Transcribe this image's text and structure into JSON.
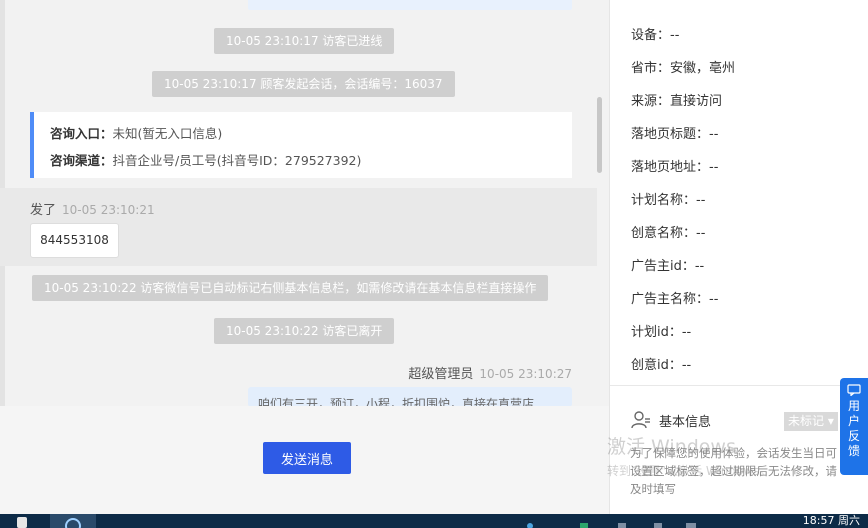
{
  "chat": {
    "events": [
      "10-05 23:10:17 访客已进线",
      "10-05 23:10:17 顾客发起会话，会话编号：16037",
      "10-05 23:10:22 访客微信号已自动标记右侧基本信息栏，如需修改请在基本信息栏直接操作",
      "10-05 23:10:22 访客已离开"
    ],
    "info_card": {
      "entry_label": "咨询入口：",
      "entry_value": "未知(暂无入口信息)",
      "channel_label": "咨询渠道：",
      "channel_value": "抖音企业号/员工号(抖音号ID：279527392)"
    },
    "visitor_message": {
      "sender": "发了",
      "time": "10-05 23:10:21",
      "content": "844553108"
    },
    "admin_message": {
      "sender": "超级管理员",
      "time": "10-05 23:10:27",
      "content": "咱们有三开，预订，小程，折扣围炉，直接在直营店"
    },
    "send_label": "发送消息"
  },
  "panel": {
    "fields": [
      "设备：--",
      "省市：安徽，亳州",
      "来源：直接访问",
      "落地页标题：--",
      "落地页地址：--",
      "计划名称：--",
      "创意名称：--",
      "广告主id：--",
      "广告主名称：--",
      "计划id：--",
      "创意id：--"
    ],
    "basic_info_title": "基本信息",
    "tag_label": "未标记",
    "hint": "为了保障您的使用体验，会话发生当日可设置区域标签，超过期限后无法修改，请及时填写",
    "watermark_title": "激活 Windows",
    "watermark_sub": "转到\"设置\"以激活 Windows。"
  },
  "feedback_label": "用户反馈",
  "taskbar": {
    "clock": "18:57 周六"
  },
  "colors": {
    "accent": "#2e5be6",
    "card_border": "#4f8cf7",
    "feedback": "#1e73e8",
    "system_message_bg": "#cfcfcf"
  }
}
